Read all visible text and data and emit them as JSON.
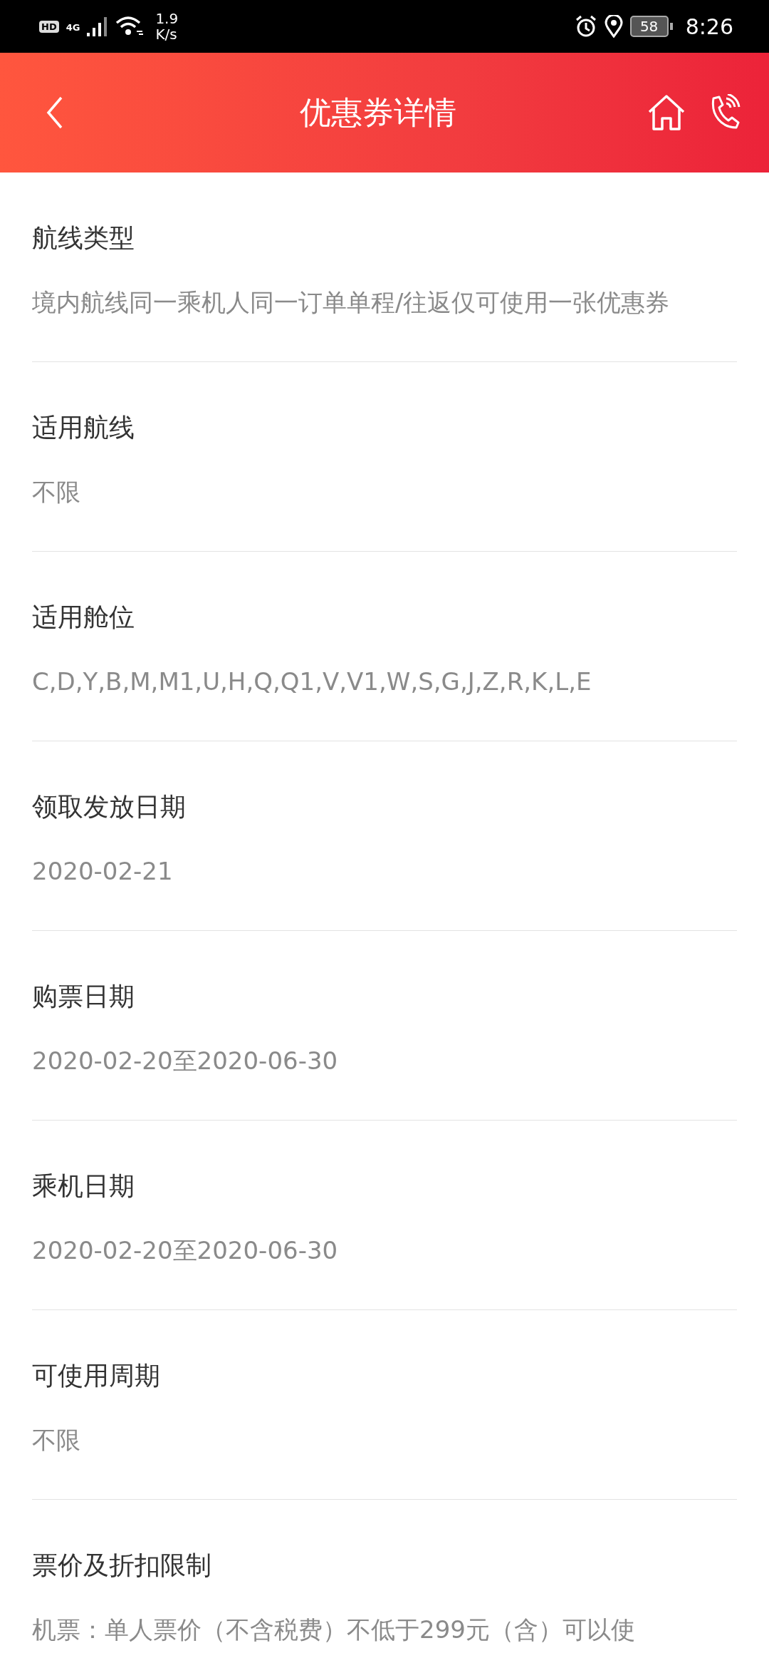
{
  "status_bar": {
    "hd": "HD",
    "network": "4G",
    "speed_value": "1.9",
    "speed_unit": "K/s",
    "battery": "58",
    "time": "8:26"
  },
  "header": {
    "title": "优惠券详情"
  },
  "sections": [
    {
      "label": "航线类型",
      "value": "境内航线同一乘机人同一订单单程/往返仅可使用一张优惠券"
    },
    {
      "label": "适用航线",
      "value": "不限"
    },
    {
      "label": "适用舱位",
      "value": "C,D,Y,B,M,M1,U,H,Q,Q1,V,V1,W,S,G,J,Z,R,K,L,E"
    },
    {
      "label": "领取发放日期",
      "value": "2020-02-21"
    },
    {
      "label": "购票日期",
      "value": "2020-02-20至2020-06-30"
    },
    {
      "label": "乘机日期",
      "value": "2020-02-20至2020-06-30"
    },
    {
      "label": "可使用周期",
      "value": "不限"
    },
    {
      "label": "票价及折扣限制",
      "value": "机票：单人票价（不含税费）不低于299元（含）可以使"
    }
  ]
}
